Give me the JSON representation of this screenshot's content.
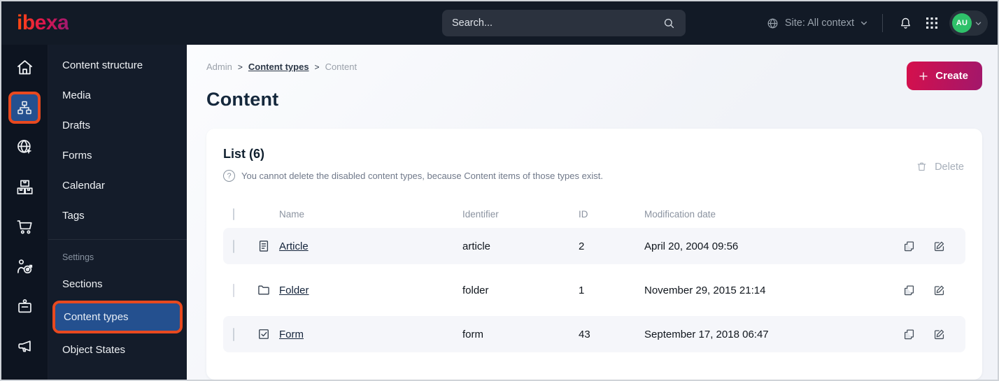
{
  "colors": {
    "topbar_bg": "#121a26",
    "rail_bg": "#0d1420",
    "sidebar_bg": "#141c2a",
    "selected_blue": "#24508f",
    "annotation_orange": "#e8491f",
    "brand_gradient": [
      "#ff4713",
      "#e2164a",
      "#a4196e"
    ],
    "avatar_green": "#2fc16a",
    "main_bg": "#f4f6f9",
    "row_alt_bg": "#f5f6fa"
  },
  "topbar": {
    "logo_text": "ibexa",
    "search_placeholder": "Search...",
    "site_context_label": "Site: All context",
    "avatar_initials": "AU"
  },
  "rail": {
    "icons": [
      "home-icon",
      "content-tree-icon",
      "site-globe-icon",
      "packages-icon",
      "cart-icon",
      "personalization-target-icon",
      "badge-icon",
      "megaphone-icon"
    ],
    "selected_icon": "content-tree-icon"
  },
  "sidebar": {
    "items": [
      "Content structure",
      "Media",
      "Drafts",
      "Forms",
      "Calendar",
      "Tags"
    ],
    "settings_label": "Settings",
    "settings_items": [
      "Sections",
      "Content types",
      "Object States"
    ],
    "selected_item": "Content types"
  },
  "breadcrumb": {
    "items": [
      "Admin",
      "Content types",
      "Content"
    ],
    "separator": ">"
  },
  "page": {
    "title": "Content",
    "create_label": "Create"
  },
  "list": {
    "title": "List (6)",
    "helper_text": "You cannot delete the disabled content types, because Content items of those types exist.",
    "delete_label": "Delete",
    "headers": {
      "name": "Name",
      "identifier": "Identifier",
      "id": "ID",
      "modified": "Modification date"
    },
    "rows": [
      {
        "name": "Article",
        "identifier": "article",
        "id": "2",
        "modified": "April 20, 2004 09:56",
        "type_icon": "article-icon",
        "checkbox_disabled": false
      },
      {
        "name": "Folder",
        "identifier": "folder",
        "id": "1",
        "modified": "November 29, 2015 21:14",
        "type_icon": "folder-icon",
        "checkbox_disabled": true
      },
      {
        "name": "Form",
        "identifier": "form",
        "id": "43",
        "modified": "September 17, 2018 06:47",
        "type_icon": "form-icon",
        "checkbox_disabled": false
      }
    ]
  }
}
